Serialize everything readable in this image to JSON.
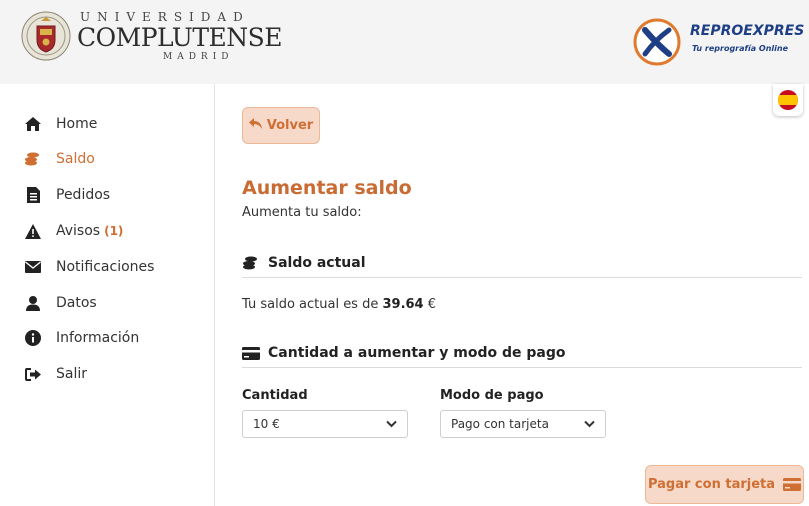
{
  "header": {
    "university_top": "UNIVERSIDAD",
    "university_main": "COMPLUTENSE",
    "university_bottom": "MADRID",
    "brand_title": "REPROEXPRES",
    "brand_subtitle": "Tu reprografía Online"
  },
  "language": {
    "icon": "spain-flag-icon"
  },
  "sidebar": {
    "items": [
      {
        "label": "Home",
        "icon": "home-icon"
      },
      {
        "label": "Saldo",
        "icon": "coins-icon",
        "active": true
      },
      {
        "label": "Pedidos",
        "icon": "document-icon"
      },
      {
        "label": "Avisos",
        "icon": "warning-icon",
        "badge": "(1)"
      },
      {
        "label": "Notificaciones",
        "icon": "envelope-icon"
      },
      {
        "label": "Datos",
        "icon": "user-icon"
      },
      {
        "label": "Información",
        "icon": "info-icon"
      },
      {
        "label": "Salir",
        "icon": "sign-out-icon"
      }
    ]
  },
  "main": {
    "back_label": "Volver",
    "title": "Aumentar saldo",
    "subtitle": "Aumenta tu saldo:",
    "balance_section": {
      "heading": "Saldo actual",
      "text_prefix": "Tu saldo actual es de",
      "amount": "39.64",
      "currency": "€"
    },
    "payment_section": {
      "heading": "Cantidad a aumentar y modo de pago",
      "amount_label": "Cantidad",
      "amount_value": "10 €",
      "method_label": "Modo de pago",
      "method_value": "Pago con tarjeta"
    },
    "pay_button_label": "Pagar con tarjeta"
  },
  "colors": {
    "accent": "#cf6f34",
    "button_bg": "#f6d9c8",
    "brand_blue": "#1e3f86"
  }
}
